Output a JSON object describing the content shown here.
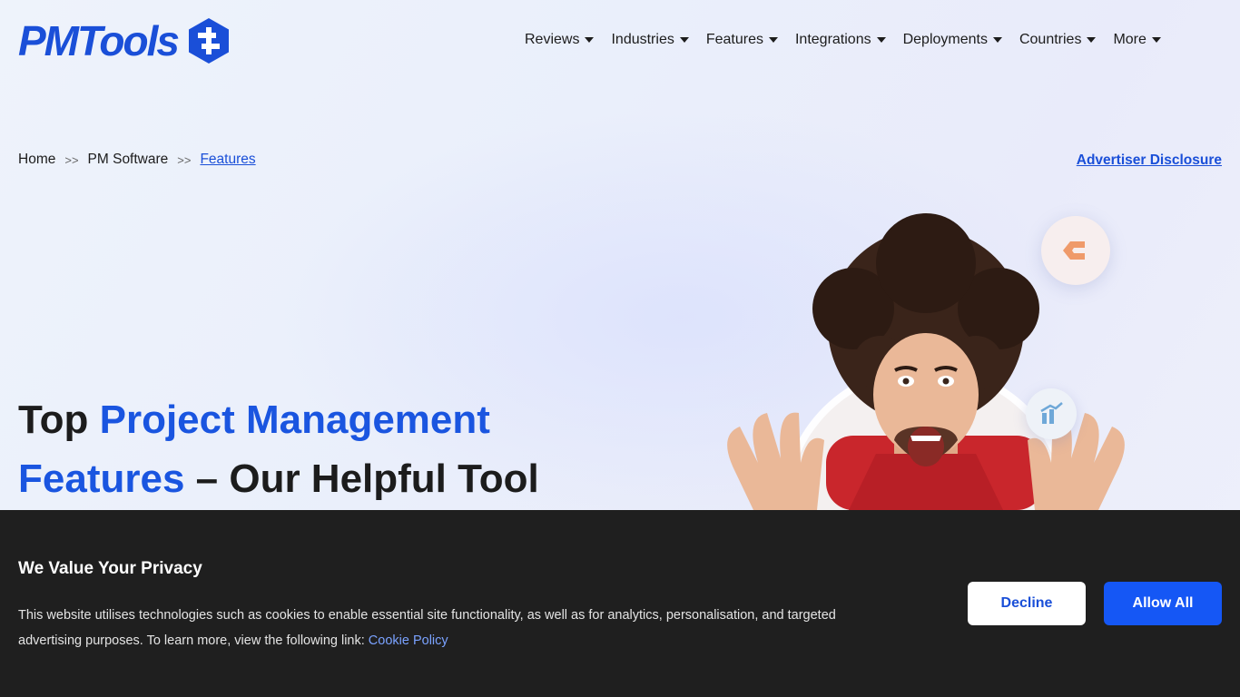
{
  "header": {
    "logo_text": "PMTools",
    "nav": [
      {
        "label": "Reviews"
      },
      {
        "label": "Industries"
      },
      {
        "label": "Features"
      },
      {
        "label": "Integrations"
      },
      {
        "label": "Deployments"
      },
      {
        "label": "Countries"
      },
      {
        "label": "More"
      }
    ]
  },
  "breadcrumb": {
    "items": [
      "Home",
      "PM Software",
      "Features"
    ],
    "separator": ">>"
  },
  "advertiser_disclosure": "Advertiser Disclosure",
  "hero": {
    "headline_part1": "Top ",
    "headline_part2": "Project Management Features",
    "headline_part3": " – Our Helpful Tool"
  },
  "cookie_banner": {
    "title": "We Value Your Privacy",
    "text": "This website utilises technologies such as cookies to enable essential site functionality, as well as for analytics, personalisation, and targeted advertising purposes. To learn more, view the following link: ",
    "link_label": "Cookie Policy",
    "decline_label": "Decline",
    "allow_label": "Allow All"
  },
  "colors": {
    "brand_blue": "#1a4fd8",
    "button_blue": "#1557f5",
    "banner_bg": "#1f1f1f"
  },
  "icons": [
    "logo-hexagon-icon",
    "caret-down-icon",
    "clickup-c-icon",
    "bar-chart-icon"
  ]
}
